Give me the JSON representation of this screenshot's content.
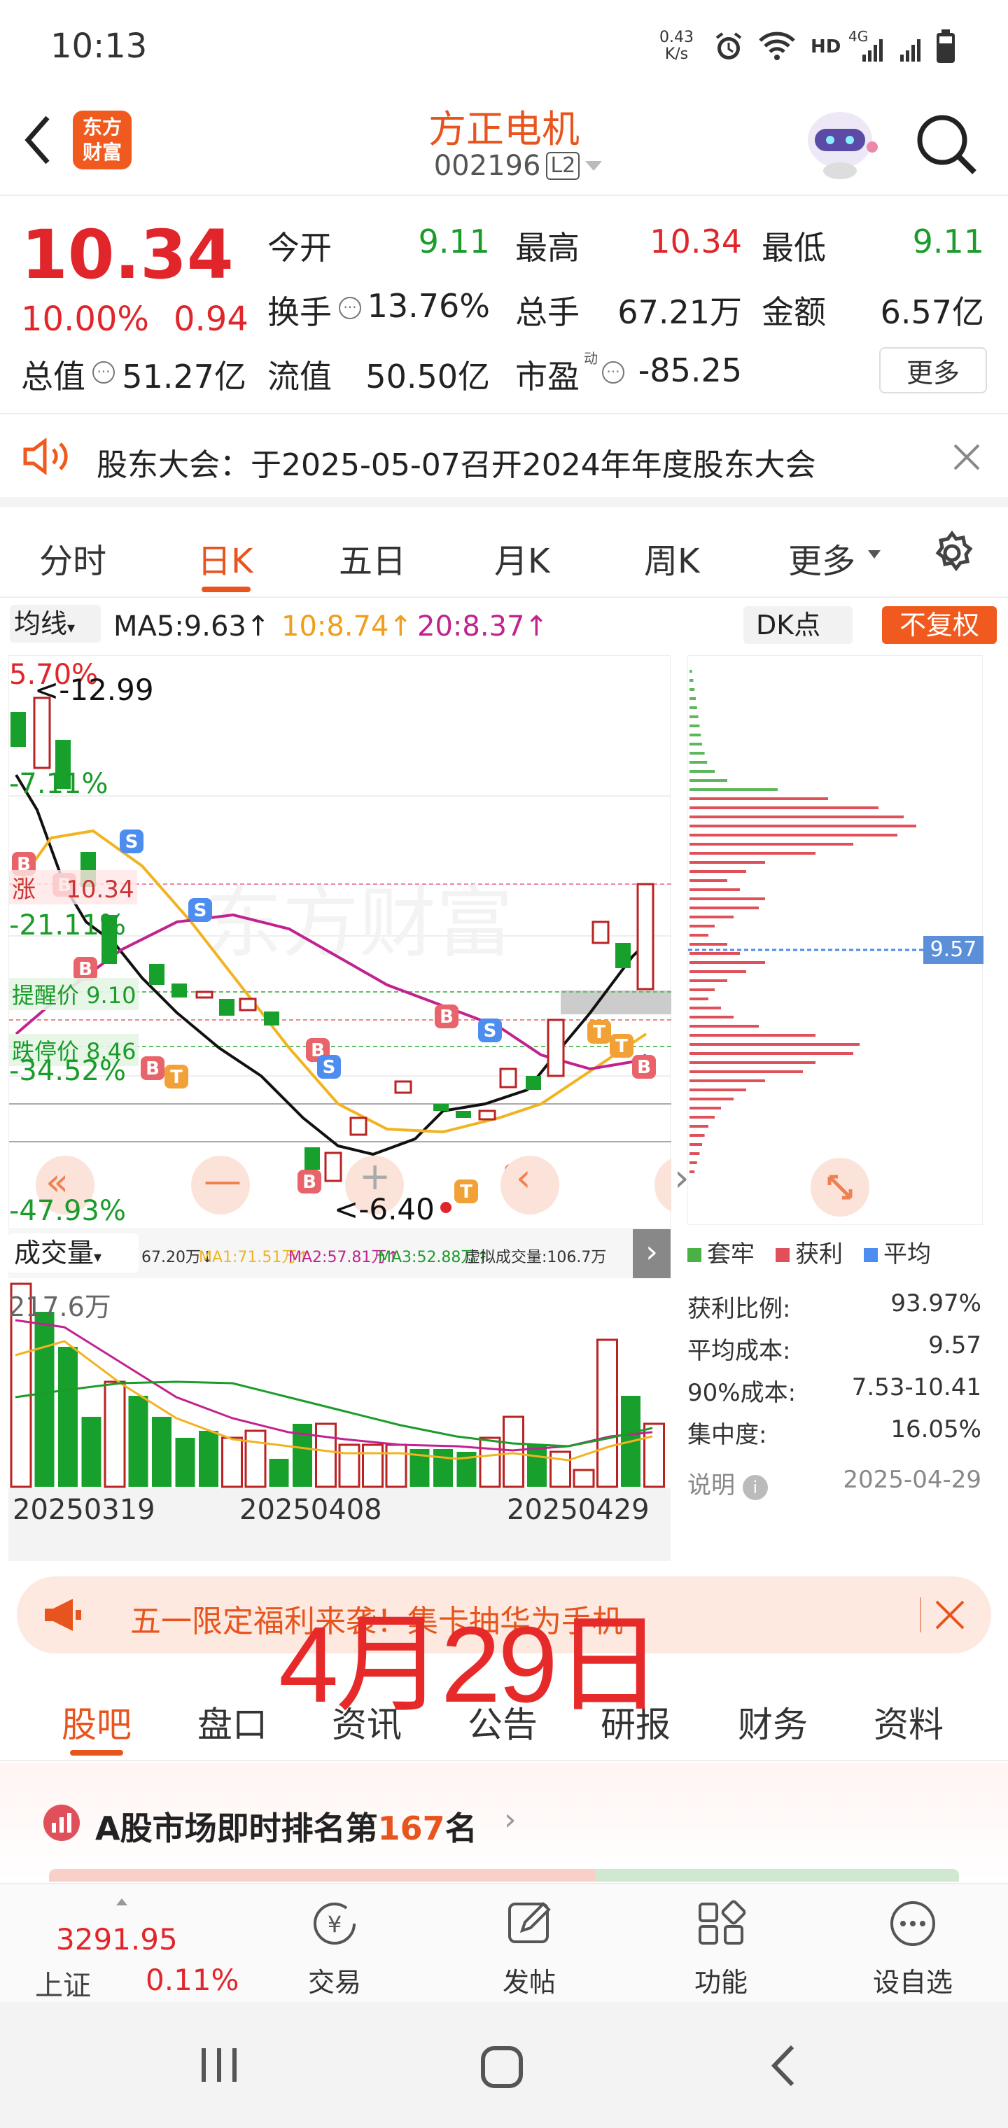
{
  "status_bar": {
    "time": "10:13",
    "net_speed_top": "0.43",
    "net_speed_bottom": "K/s",
    "hd": "HD",
    "signal": "4G"
  },
  "header": {
    "logo_line1": "东方",
    "logo_line2": "财富",
    "stock_name": "方正电机",
    "stock_code": "002196",
    "level_badge": "L2"
  },
  "quote": {
    "price": "10.34",
    "change_pct": "10.00%",
    "change_amt": "0.94",
    "open_label": "今开",
    "open_value": "9.11",
    "high_label": "最高",
    "high_value": "10.34",
    "low_label": "最低",
    "low_value": "9.11",
    "turnover_label": "换手",
    "turnover_value": "13.76%",
    "volume_label": "总手",
    "volume_value": "67.21万",
    "amount_label": "金额",
    "amount_value": "6.57亿",
    "mktcap_label": "总值",
    "mktcap_value": "51.27亿",
    "float_label": "流值",
    "float_value": "50.50亿",
    "pe_label": "市盈",
    "pe_sup": "动",
    "pe_value": "-85.25",
    "more_button": "更多"
  },
  "notice": {
    "text": "股东大会：于2025-05-07召开2024年年度股东大会"
  },
  "period_tabs": [
    "分时",
    "日K",
    "五日",
    "月K",
    "周K",
    "更多"
  ],
  "ma_bar": {
    "selector": "均线",
    "ma5": "MA5:9.63",
    "ma10": "10:8.74",
    "ma20": "20:8.37",
    "dk_button": "DK点",
    "fq_button": "不复权"
  },
  "kline": {
    "labels": {
      "top_pct": "5.70%",
      "high_marker": "<-12.99",
      "pct2": "-7.11%",
      "zhang": "涨",
      "zhang_value": "10.34",
      "pct3": "-21.11%",
      "tixing": "提醒价 9.10",
      "dieting": "跌停价 8.46",
      "pct4": "-34.52%",
      "low_marker": "<-6.40",
      "pct5": "-47.93%"
    },
    "watermark": "东方财富"
  },
  "chip": {
    "price_tag": "9.57",
    "legend": [
      "套牢",
      "获利",
      "平均"
    ],
    "rows": [
      {
        "label": "获利比例:",
        "value": "93.97%"
      },
      {
        "label": "平均成本:",
        "value": "9.57"
      },
      {
        "label": "90%成本:",
        "value": "7.53-10.41"
      },
      {
        "label": "集中度:",
        "value": "16.05%"
      }
    ],
    "note_label": "说明",
    "note_date": "2025-04-29"
  },
  "volume": {
    "selector": "成交量",
    "stats": "67.20万↓",
    "ma1": "MA1:71.51万↑",
    "ma2": "MA2:57.81万↑",
    "ma3": "MA3:52.88万↑",
    "virtual": "虚拟成交量:106.7万",
    "axis_max": "217.6万",
    "dates": [
      "20250319",
      "20250408",
      "20250429"
    ]
  },
  "promo": {
    "text": "五一限定福利来袭！集卡抽华为手机"
  },
  "overlay_date": "4月29日",
  "bottom_tabs": [
    "股吧",
    "盘口",
    "资讯",
    "公告",
    "研报",
    "财务",
    "资料"
  ],
  "rank": {
    "prefix": "A股市场即时排名第",
    "number": "167",
    "suffix": "名"
  },
  "bottom_nav": {
    "index_value": "3291.95",
    "index_name": "上证",
    "index_pct": "0.11%",
    "items": [
      "交易",
      "发帖",
      "功能",
      "设自选"
    ]
  }
}
